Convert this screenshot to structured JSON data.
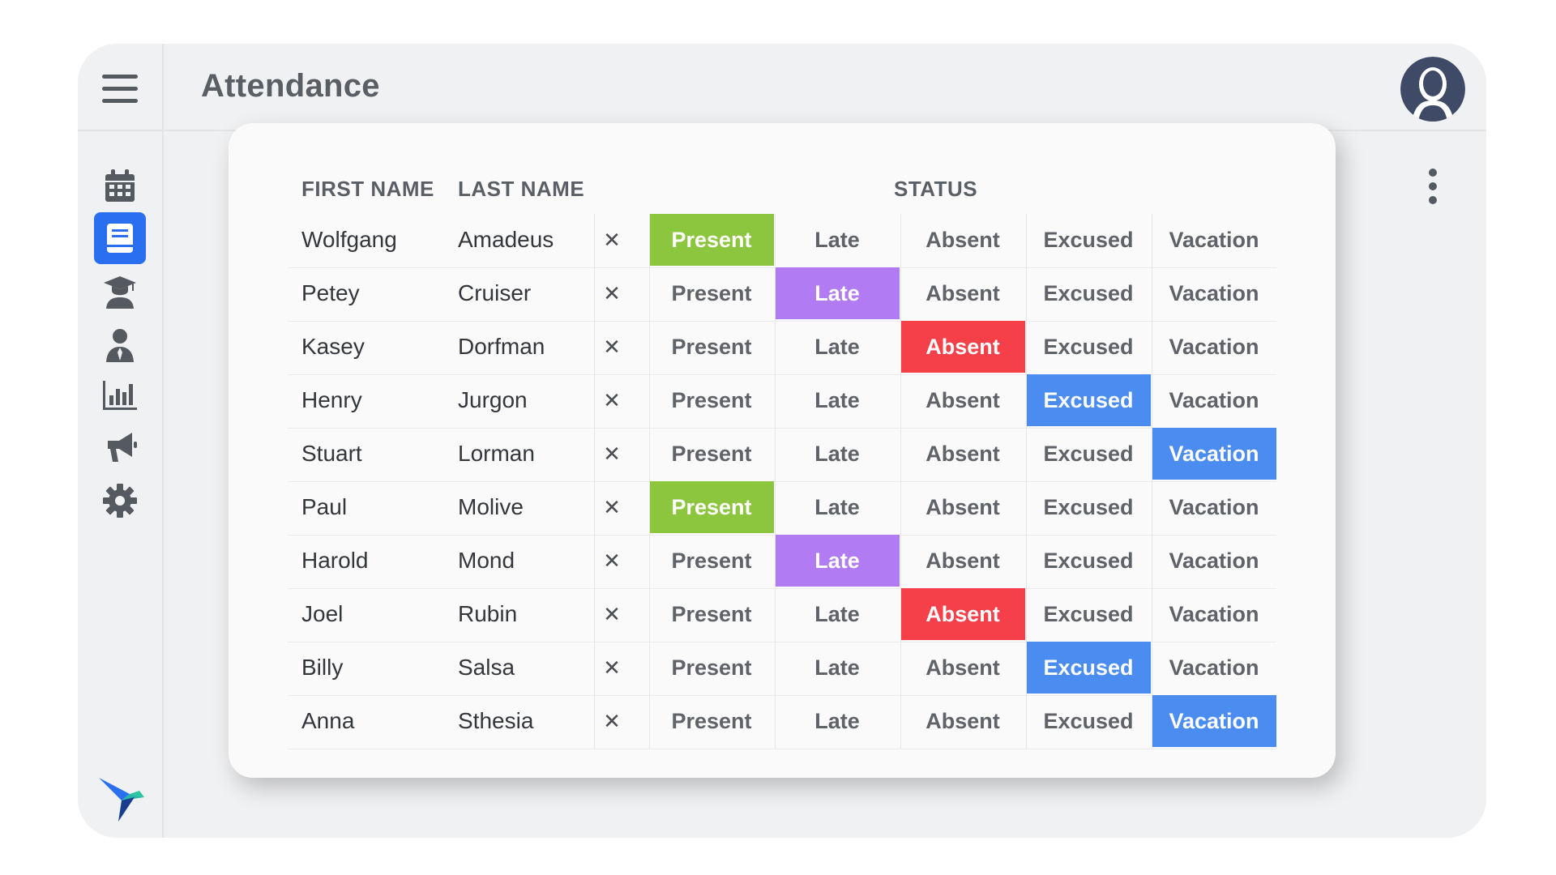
{
  "header": {
    "title": "Attendance"
  },
  "table": {
    "headers": {
      "first_name": "FIRST NAME",
      "last_name": "LAST NAME",
      "status": "STATUS"
    },
    "clear_symbol": "✕",
    "status_options": [
      "Present",
      "Late",
      "Absent",
      "Excused",
      "Vacation"
    ],
    "status_colors": {
      "Present": "#8cc63f",
      "Late": "#b07bf3",
      "Absent": "#f5404a",
      "Excused": "#4a8cf0",
      "Vacation": "#4a8cf0"
    },
    "rows": [
      {
        "first": "Wolfgang",
        "last": "Amadeus",
        "status": "Present"
      },
      {
        "first": "Petey",
        "last": "Cruiser",
        "status": "Late"
      },
      {
        "first": "Kasey",
        "last": "Dorfman",
        "status": "Absent"
      },
      {
        "first": "Henry",
        "last": "Jurgon",
        "status": "Excused"
      },
      {
        "first": "Stuart",
        "last": "Lorman",
        "status": "Vacation"
      },
      {
        "first": "Paul",
        "last": "Molive",
        "status": "Present"
      },
      {
        "first": "Harold",
        "last": "Mond",
        "status": "Late"
      },
      {
        "first": "Joel",
        "last": "Rubin",
        "status": "Absent"
      },
      {
        "first": "Billy",
        "last": "Salsa",
        "status": "Excused"
      },
      {
        "first": "Anna",
        "last": "Sthesia",
        "status": "Vacation"
      }
    ]
  },
  "sidebar": {
    "items": [
      {
        "icon": "calendar-icon",
        "active": false
      },
      {
        "icon": "book-icon",
        "active": true
      },
      {
        "icon": "graduate-icon",
        "active": false
      },
      {
        "icon": "user-icon",
        "active": false
      },
      {
        "icon": "bar-chart-icon",
        "active": false
      },
      {
        "icon": "megaphone-icon",
        "active": false
      },
      {
        "icon": "gear-icon",
        "active": false
      }
    ],
    "logo": "bird-logo"
  },
  "colors": {
    "accent": "#2a6ff0",
    "icon": "#555a61"
  }
}
